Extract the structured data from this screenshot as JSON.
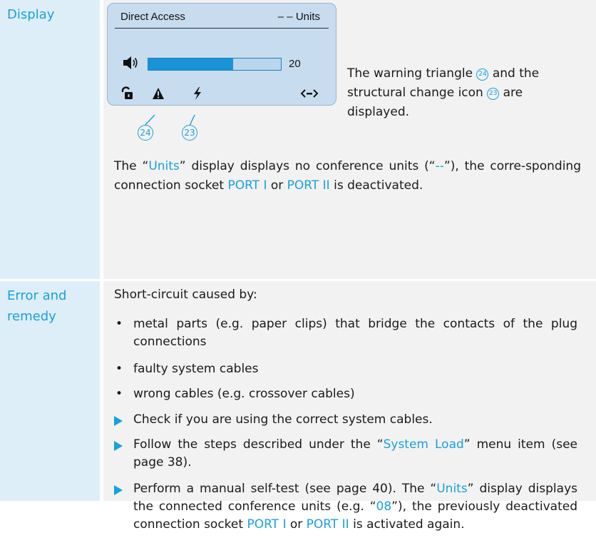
{
  "display_row": {
    "label": "Display",
    "lcd": {
      "title": "Direct Access",
      "units_text": "– – Units",
      "volume_value": "20",
      "volume_fraction": 0.64,
      "icons": [
        "volume-icon",
        "lock-icon",
        "warning-triangle-icon",
        "structural-change-icon",
        "connection-icon"
      ]
    },
    "callouts": [
      "24",
      "23"
    ],
    "side_text": {
      "part1": "The warning triangle ",
      "num1": "24",
      "part2": " and the structural change icon ",
      "num2": "23",
      "part3": " are displayed."
    },
    "units_note": {
      "p1": "The “",
      "units_word": "Units",
      "p2": "” display displays no conference units (“",
      "dashes": "--",
      "p3": "”), the corre-sponding connection socket ",
      "port1": "PORT I",
      "p4": " or ",
      "port2": "PORT II",
      "p5": " is deactivated."
    }
  },
  "error_row": {
    "label": "Error and remedy",
    "intro": "Short-circuit caused by:",
    "bullets": [
      "metal parts (e.g. paper clips) that bridge the contacts of the plug connections",
      "faulty system cables",
      "wrong cables (e.g. crossover cables)"
    ],
    "steps": {
      "s1": "Check if you are using the correct system cables.",
      "s2_a": "Follow the steps described under the “",
      "s2_link": "System Load",
      "s2_b": "” menu item (see page 38).",
      "s3_a": "Perform a manual self-test (see page 40).",
      "s3_b": "The “",
      "s3_units": "Units",
      "s3_c": "” display displays the connected conference units (e.g. “",
      "s3_num": "08",
      "s3_d": "”), the previously deactivated connection socket ",
      "s3_port1": "PORT I",
      "s3_e": " or ",
      "s3_port2": "PORT II",
      "s3_f": " is activated again."
    }
  },
  "colors": {
    "accent": "#1aa0dc",
    "label_bg": "#ddeef9",
    "content_bg": "#f2f2f2",
    "lcd_bg": "#c8dcef"
  }
}
